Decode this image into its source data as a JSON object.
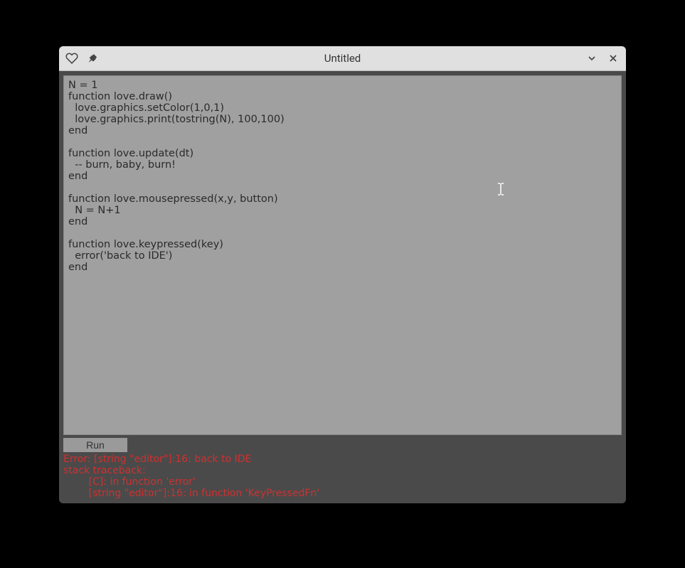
{
  "window": {
    "title": "Untitled"
  },
  "editor": {
    "content": "N = 1\nfunction love.draw()\n  love.graphics.setColor(1,0,1)\n  love.graphics.print(tostring(N), 100,100)\nend\n\nfunction love.update(dt)\n  -- burn, baby, burn!\nend\n\nfunction love.mousepressed(x,y, button)\n  N = N+1\nend\n\nfunction love.keypressed(key)\n  error('back to IDE')\nend"
  },
  "controls": {
    "run_label": "Run"
  },
  "error": {
    "text": "Error: [string \"editor\"]:16: back to IDE\nstack traceback:\n        [C]: in function 'error'\n        [string \"editor\"]:16: in function 'KeyPressedFn'"
  },
  "icons": {
    "heart": "heart-icon",
    "pin": "pin-icon",
    "minimize": "chevron-down-icon",
    "close": "close-icon"
  }
}
